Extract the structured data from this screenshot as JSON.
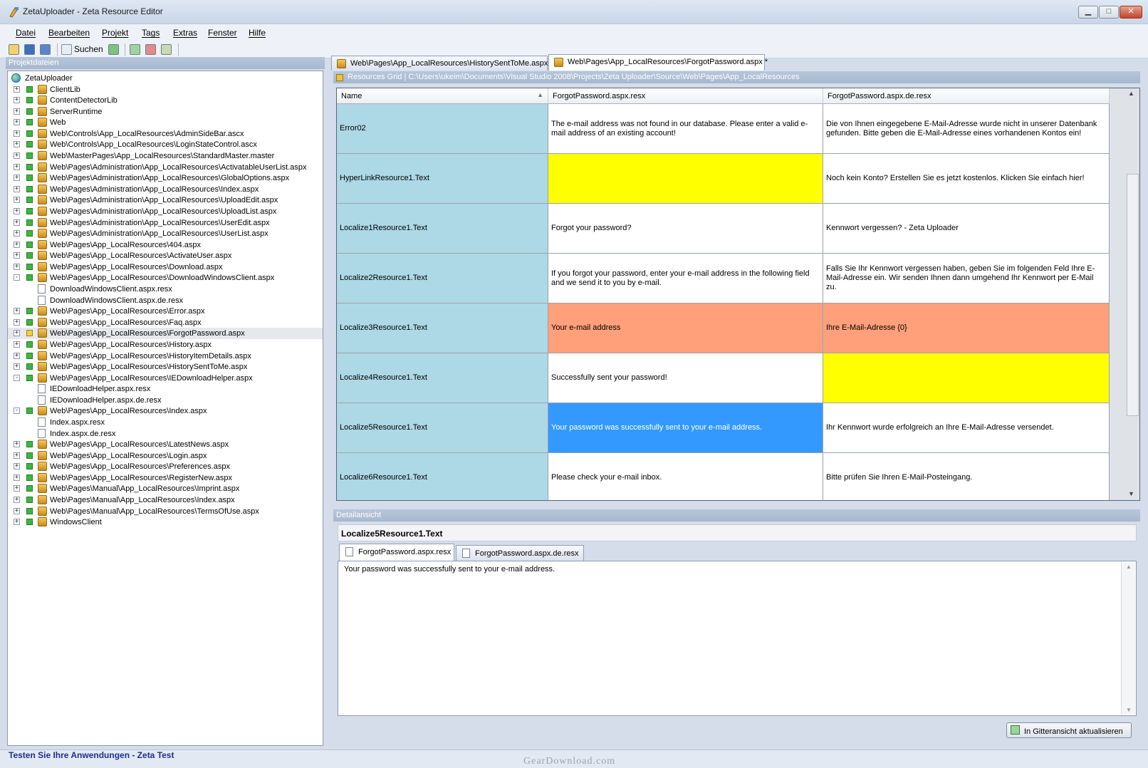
{
  "window": {
    "title": "ZetaUploader - Zeta Resource Editor"
  },
  "menu": [
    "Datei",
    "Bearbeiten",
    "Projekt",
    "Tags",
    "Extras",
    "Fenster",
    "Hilfe"
  ],
  "toolbar": {
    "search_label": "Suchen"
  },
  "project_pane": {
    "header": "Projektdateien",
    "items": [
      {
        "label": "ZetaUploader",
        "level": 0,
        "icon": "globe-icon",
        "expander": "",
        "status": ""
      },
      {
        "label": "ClientLib",
        "level": 1,
        "icon": "package-icon",
        "expander": "+",
        "status": "green"
      },
      {
        "label": "ContentDetectorLib",
        "level": 1,
        "icon": "package-icon",
        "expander": "+",
        "status": "green"
      },
      {
        "label": "ServerRuntime",
        "level": 1,
        "icon": "package-icon",
        "expander": "+",
        "status": "green"
      },
      {
        "label": "Web",
        "level": 1,
        "icon": "package-icon",
        "expander": "+",
        "status": "green"
      },
      {
        "label": "Web\\Controls\\App_LocalResources\\AdminSideBar.ascx",
        "level": 1,
        "icon": "package-icon",
        "expander": "+",
        "status": "green"
      },
      {
        "label": "Web\\Controls\\App_LocalResources\\LoginStateControl.ascx",
        "level": 1,
        "icon": "package-icon",
        "expander": "+",
        "status": "green"
      },
      {
        "label": "Web\\MasterPages\\App_LocalResources\\StandardMaster.master",
        "level": 1,
        "icon": "package-icon",
        "expander": "+",
        "status": "green"
      },
      {
        "label": "Web\\Pages\\Administration\\App_LocalResources\\ActivatableUserList.aspx",
        "level": 1,
        "icon": "package-icon",
        "expander": "+",
        "status": "green"
      },
      {
        "label": "Web\\Pages\\Administration\\App_LocalResources\\GlobalOptions.aspx",
        "level": 1,
        "icon": "package-icon",
        "expander": "+",
        "status": "green"
      },
      {
        "label": "Web\\Pages\\Administration\\App_LocalResources\\Index.aspx",
        "level": 1,
        "icon": "package-icon",
        "expander": "+",
        "status": "green"
      },
      {
        "label": "Web\\Pages\\Administration\\App_LocalResources\\UploadEdit.aspx",
        "level": 1,
        "icon": "package-icon",
        "expander": "+",
        "status": "green"
      },
      {
        "label": "Web\\Pages\\Administration\\App_LocalResources\\UploadList.aspx",
        "level": 1,
        "icon": "package-icon",
        "expander": "+",
        "status": "green"
      },
      {
        "label": "Web\\Pages\\Administration\\App_LocalResources\\UserEdit.aspx",
        "level": 1,
        "icon": "package-icon",
        "expander": "+",
        "status": "green"
      },
      {
        "label": "Web\\Pages\\Administration\\App_LocalResources\\UserList.aspx",
        "level": 1,
        "icon": "package-icon",
        "expander": "+",
        "status": "green"
      },
      {
        "label": "Web\\Pages\\App_LocalResources\\404.aspx",
        "level": 1,
        "icon": "package-icon",
        "expander": "+",
        "status": "green"
      },
      {
        "label": "Web\\Pages\\App_LocalResources\\ActivateUser.aspx",
        "level": 1,
        "icon": "package-icon",
        "expander": "+",
        "status": "green"
      },
      {
        "label": "Web\\Pages\\App_LocalResources\\Download.aspx",
        "level": 1,
        "icon": "package-icon",
        "expander": "+",
        "status": "green"
      },
      {
        "label": "Web\\Pages\\App_LocalResources\\DownloadWindowsClient.aspx",
        "level": 1,
        "icon": "package-icon",
        "expander": "-",
        "status": "green"
      },
      {
        "label": "DownloadWindowsClient.aspx.resx",
        "level": 2,
        "icon": "file-icon",
        "expander": "",
        "status": ""
      },
      {
        "label": "DownloadWindowsClient.aspx.de.resx",
        "level": 2,
        "icon": "file-icon",
        "expander": "",
        "status": ""
      },
      {
        "label": "Web\\Pages\\App_LocalResources\\Error.aspx",
        "level": 1,
        "icon": "package-icon",
        "expander": "+",
        "status": "green"
      },
      {
        "label": "Web\\Pages\\App_LocalResources\\Faq.aspx",
        "level": 1,
        "icon": "package-icon",
        "expander": "+",
        "status": "green"
      },
      {
        "label": "Web\\Pages\\App_LocalResources\\ForgotPassword.aspx",
        "level": 1,
        "icon": "package-icon",
        "expander": "+",
        "status": "yellow",
        "selected": true
      },
      {
        "label": "Web\\Pages\\App_LocalResources\\History.aspx",
        "level": 1,
        "icon": "package-icon",
        "expander": "+",
        "status": "green"
      },
      {
        "label": "Web\\Pages\\App_LocalResources\\HistoryItemDetails.aspx",
        "level": 1,
        "icon": "package-icon",
        "expander": "+",
        "status": "green"
      },
      {
        "label": "Web\\Pages\\App_LocalResources\\HistorySentToMe.aspx",
        "level": 1,
        "icon": "package-icon",
        "expander": "+",
        "status": "green"
      },
      {
        "label": "Web\\Pages\\App_LocalResources\\IEDownloadHelper.aspx",
        "level": 1,
        "icon": "package-icon",
        "expander": "-",
        "status": "green"
      },
      {
        "label": "IEDownloadHelper.aspx.resx",
        "level": 2,
        "icon": "file-icon",
        "expander": "",
        "status": ""
      },
      {
        "label": "IEDownloadHelper.aspx.de.resx",
        "level": 2,
        "icon": "file-icon",
        "expander": "",
        "status": ""
      },
      {
        "label": "Web\\Pages\\App_LocalResources\\Index.aspx",
        "level": 1,
        "icon": "package-icon",
        "expander": "-",
        "status": "green"
      },
      {
        "label": "Index.aspx.resx",
        "level": 2,
        "icon": "file-icon",
        "expander": "",
        "status": ""
      },
      {
        "label": "Index.aspx.de.resx",
        "level": 2,
        "icon": "file-icon",
        "expander": "",
        "status": ""
      },
      {
        "label": "Web\\Pages\\App_LocalResources\\LatestNews.aspx",
        "level": 1,
        "icon": "package-icon",
        "expander": "+",
        "status": "green"
      },
      {
        "label": "Web\\Pages\\App_LocalResources\\Login.aspx",
        "level": 1,
        "icon": "package-icon",
        "expander": "+",
        "status": "green"
      },
      {
        "label": "Web\\Pages\\App_LocalResources\\Preferences.aspx",
        "level": 1,
        "icon": "package-icon",
        "expander": "+",
        "status": "green"
      },
      {
        "label": "Web\\Pages\\App_LocalResources\\RegisterNew.aspx",
        "level": 1,
        "icon": "package-icon",
        "expander": "+",
        "status": "green"
      },
      {
        "label": "Web\\Pages\\Manual\\App_LocalResources\\Imprint.aspx",
        "level": 1,
        "icon": "package-icon",
        "expander": "+",
        "status": "green"
      },
      {
        "label": "Web\\Pages\\Manual\\App_LocalResources\\Index.aspx",
        "level": 1,
        "icon": "package-icon",
        "expander": "+",
        "status": "green"
      },
      {
        "label": "Web\\Pages\\Manual\\App_LocalResources\\TermsOfUse.aspx",
        "level": 1,
        "icon": "package-icon",
        "expander": "+",
        "status": "green"
      },
      {
        "label": "WindowsClient",
        "level": 1,
        "icon": "package-icon",
        "expander": "+",
        "status": "green"
      }
    ]
  },
  "doc_tabs": [
    {
      "label": "Web\\Pages\\App_LocalResources\\HistorySentToMe.aspx",
      "active": false
    },
    {
      "label": "Web\\Pages\\App_LocalResources\\ForgotPassword.aspx *",
      "active": true
    }
  ],
  "grid": {
    "header": "Resources Grid  |  C:\\Users\\ukeim\\Documents\\Visual Studio 2008\\Projects\\Zeta Uploader\\Source\\Web\\Pages\\App_LocalResources",
    "columns": [
      "Name",
      "ForgotPassword.aspx.resx",
      "ForgotPassword.aspx.de.resx"
    ],
    "sort_glyph": "▲",
    "rows": [
      {
        "name": "Error02",
        "en": "The e-mail address was not found in our database. Please enter a valid e-mail address of an existing account!",
        "de": "Die von Ihnen eingegebene E-Mail-Adresse wurde nicht in unserer Datenbank gefunden. Bitte geben die E-Mail-Adresse eines vorhandenen Kontos ein!",
        "en_bg": "#ffffff",
        "de_bg": "#ffffff",
        "en_fg": "#000000"
      },
      {
        "name": "HyperLinkResource1.Text",
        "en": "",
        "de": "Noch kein Konto? Erstellen Sie es jetzt kostenlos. Klicken Sie einfach hier!",
        "en_bg": "#ffff00",
        "de_bg": "#ffffff",
        "en_fg": "#000000"
      },
      {
        "name": "Localize1Resource1.Text",
        "en": "Forgot your password?",
        "de": "Kennwort vergessen? - Zeta Uploader",
        "en_bg": "#ffffff",
        "de_bg": "#ffffff",
        "en_fg": "#000000"
      },
      {
        "name": "Localize2Resource1.Text",
        "en": "If you forgot your password, enter your e-mail address in the following field and we send it to you by e-mail.",
        "de": "Falls Sie Ihr Kennwort vergessen haben, geben Sie im folgenden Feld Ihre E-Mail-Adresse ein. Wir senden Ihnen dann umgehend Ihr Kennwort per E-Mail zu.",
        "en_bg": "#ffffff",
        "de_bg": "#ffffff",
        "en_fg": "#000000"
      },
      {
        "name": "Localize3Resource1.Text",
        "en": "Your e-mail address",
        "de": "Ihre E-Mail-Adresse {0}",
        "en_bg": "#ffa07a",
        "de_bg": "#ffa07a",
        "en_fg": "#000000"
      },
      {
        "name": "Localize4Resource1.Text",
        "en": "Successfully sent your password!",
        "de": "",
        "en_bg": "#ffffff",
        "de_bg": "#ffff00",
        "en_fg": "#000000"
      },
      {
        "name": "Localize5Resource1.Text",
        "en": "Your password was successfully sent to your e-mail address.",
        "de": "Ihr Kennwort wurde erfolgreich an Ihre E-Mail-Adresse versendet.",
        "en_bg": "#3399ff",
        "de_bg": "#ffffff",
        "en_fg": "#ffffff"
      },
      {
        "name": "Localize6Resource1.Text",
        "en": "Please check your e-mail inbox.",
        "de": "Bitte prüfen Sie Ihren E-Mail-Posteingang.",
        "en_bg": "#ffffff",
        "de_bg": "#ffffff",
        "en_fg": "#000000"
      }
    ]
  },
  "detail": {
    "header": "Detailansicht",
    "title": "Localize5Resource1.Text",
    "tabs": [
      "ForgotPassword.aspx.resx",
      "ForgotPassword.aspx.de.resx"
    ],
    "editor_value": "Your password was successfully sent to your e-mail address.",
    "update_button": "In Gitteransicht aktualisieren"
  },
  "status": {
    "text": "Testen Sie Ihre Anwendungen - Zeta Test"
  },
  "watermark": "GearDownload.com",
  "colors": {
    "name_column": "#add8e6",
    "selected_cell": "#3399ff",
    "missing_translation": "#ffff00",
    "placeholder_mismatch": "#ffa07a",
    "status_text": "#1c2f8c"
  }
}
